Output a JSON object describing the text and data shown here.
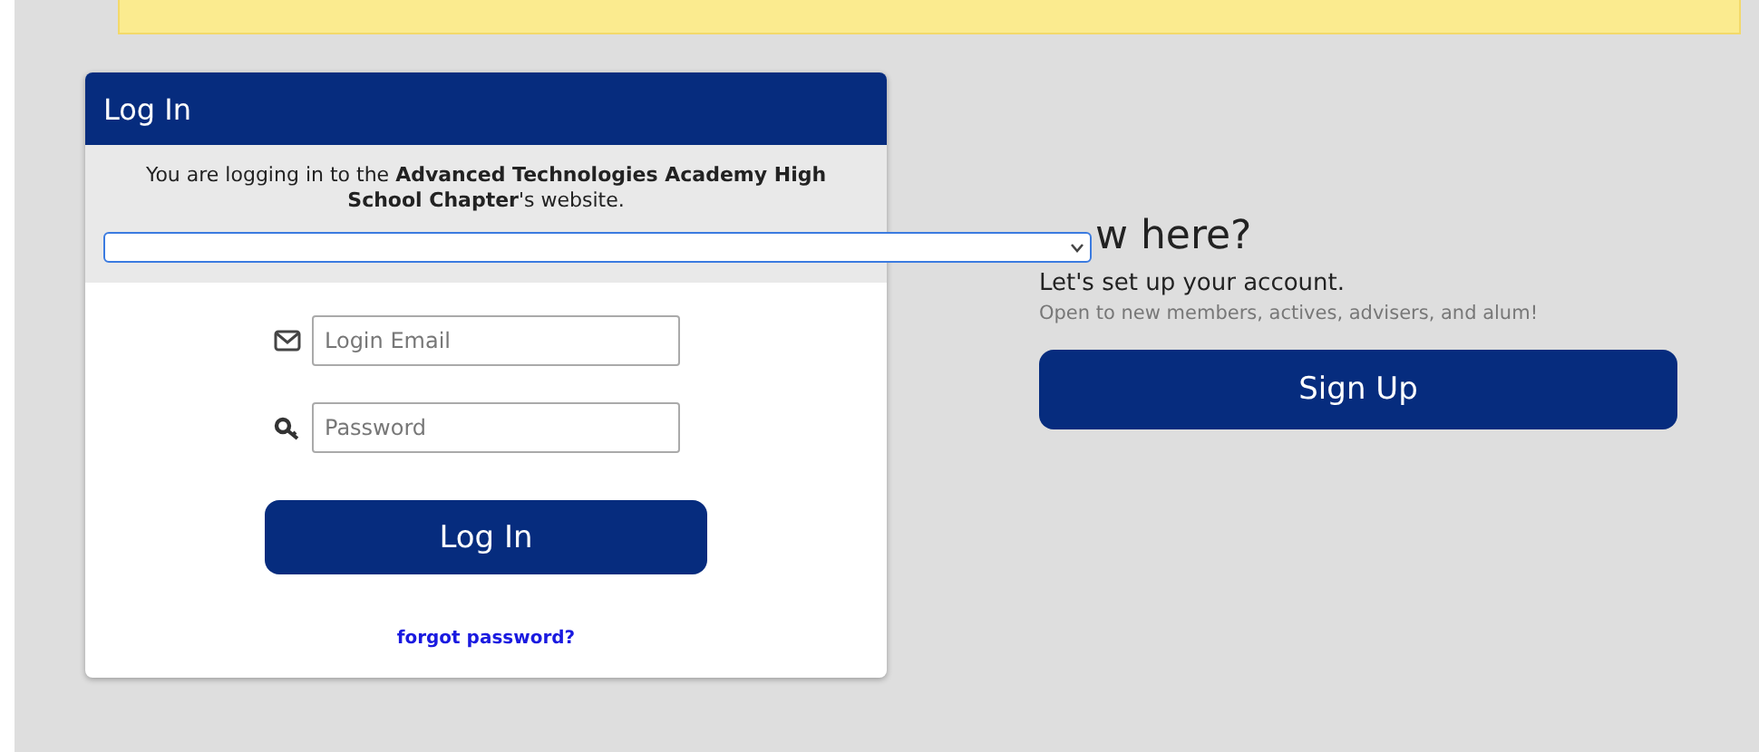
{
  "banner": {
    "kind": "notice"
  },
  "login": {
    "title": "Log In",
    "intro": "You are logging in to the **Advanced Technologies Academy High School Chapter**'s website.",
    "chapter_select": {
      "expanded": false
    },
    "email": {
      "placeholder": "Login Email"
    },
    "password": {
      "placeholder": "Password"
    },
    "submit": "Log In",
    "forgot": "forgot password?"
  },
  "signup": {
    "heading": "w here?",
    "subheading": "Let's set up your account.",
    "note": "Open to new members, actives, advisers, and alum!",
    "button": "Sign Up"
  }
}
